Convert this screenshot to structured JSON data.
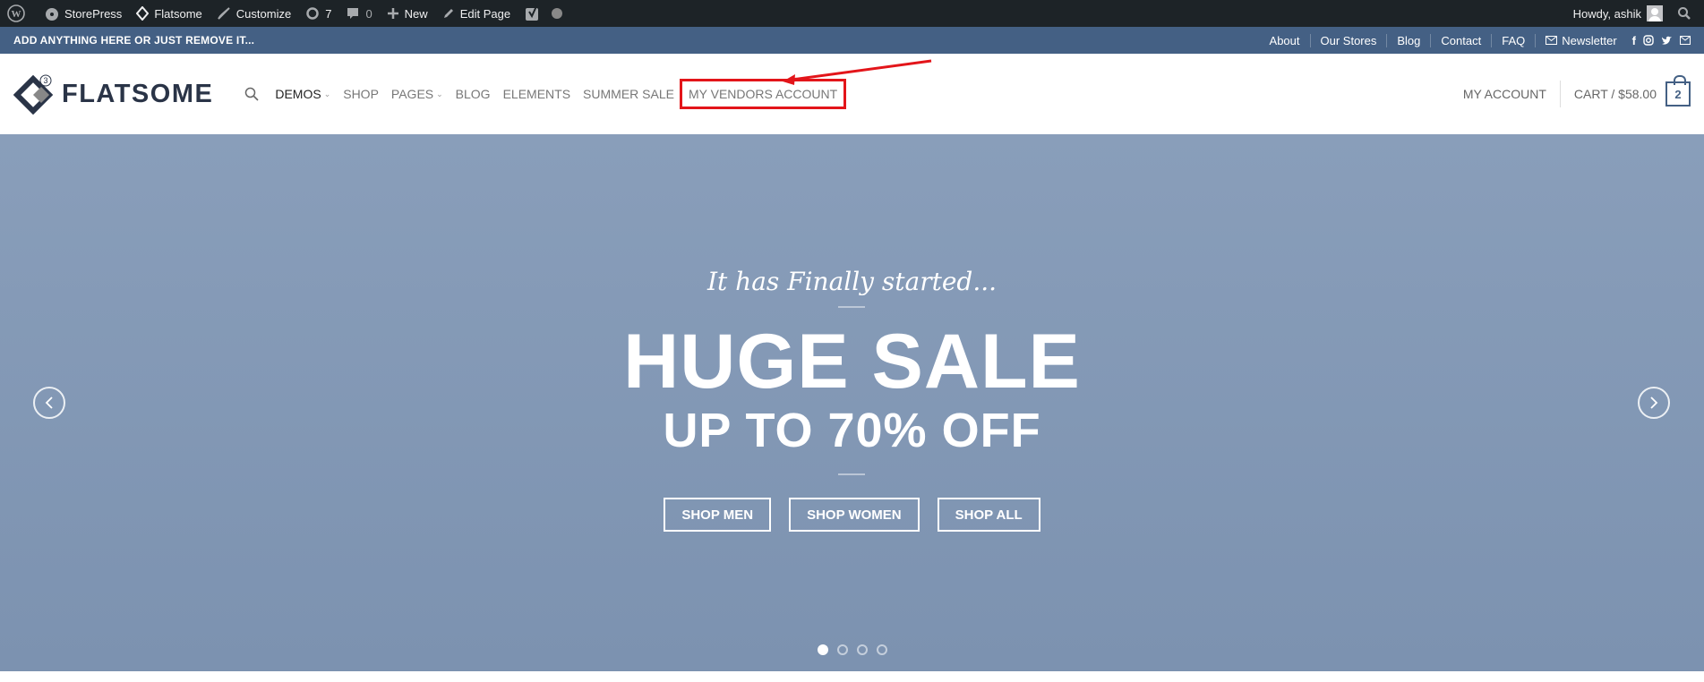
{
  "admin_bar": {
    "site_name": "StorePress",
    "theme": "Flatsome",
    "customize": "Customize",
    "updates_count": "7",
    "comments_count": "0",
    "new_label": "New",
    "edit_page": "Edit Page",
    "howdy": "Howdy, ashik"
  },
  "top_bar": {
    "message": "ADD ANYTHING HERE OR JUST REMOVE IT...",
    "links": [
      "About",
      "Our Stores",
      "Blog",
      "Contact",
      "FAQ"
    ],
    "newsletter": "Newsletter",
    "social_icons": [
      "facebook-icon",
      "instagram-icon",
      "twitter-icon",
      "email-icon"
    ]
  },
  "header": {
    "logo_text": "FLATSOME",
    "logo_badge": "3",
    "nav": [
      {
        "label": "DEMOS",
        "dropdown": true
      },
      {
        "label": "SHOP",
        "dropdown": false
      },
      {
        "label": "PAGES",
        "dropdown": true
      },
      {
        "label": "BLOG",
        "dropdown": false
      },
      {
        "label": "ELEMENTS",
        "dropdown": false
      },
      {
        "label": "SUMMER SALE",
        "dropdown": false
      },
      {
        "label": "MY VENDORS ACCOUNT",
        "dropdown": false,
        "highlighted": true
      }
    ],
    "my_account": "MY ACCOUNT",
    "cart_label": "CART / $58.00",
    "cart_count": "2"
  },
  "hero": {
    "kicker": "It has Finally started...",
    "title": "HUGE SALE",
    "subtitle": "UP TO 70% OFF",
    "buttons": [
      "SHOP MEN",
      "SHOP WOMEN",
      "SHOP ALL"
    ],
    "slides_total": 4,
    "active_slide": 1
  },
  "colors": {
    "primary": "#446084",
    "admin_bar": "#1d2327",
    "annotation": "#e3151a"
  }
}
